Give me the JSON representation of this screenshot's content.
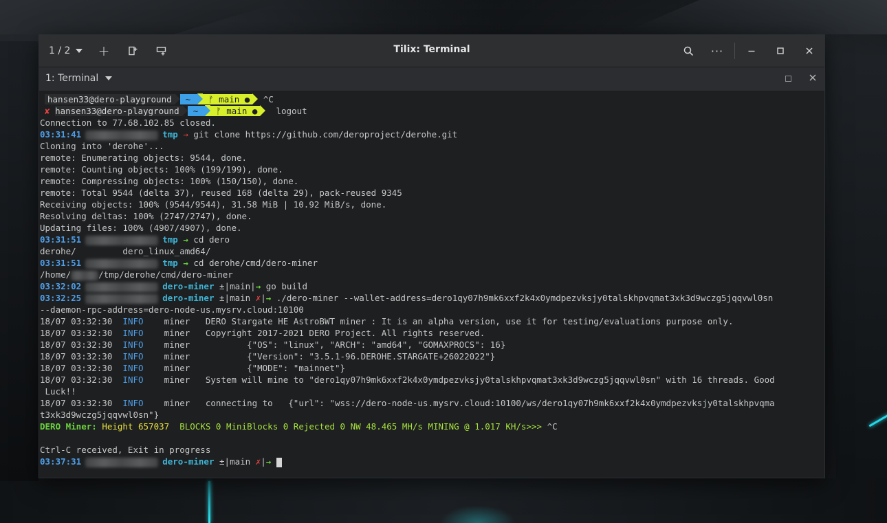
{
  "window": {
    "title": "Tilix: Terminal",
    "session_switcher": "1 / 2",
    "terminal_title": "1: Terminal"
  },
  "prompts": {
    "remote_user": "hansen33@dero-playground",
    "remote_dir": "~",
    "remote_branch": "ᚠ main ●",
    "x_mark": "✘",
    "ctrl_c": "^C",
    "logout": "logout"
  },
  "lines": {
    "l3": "Connection to 77.68.102.85 closed.",
    "p1_time": "03:31:41",
    "p1_dir": "tmp",
    "p1_cmd": "git clone https://github.com/deroproject/derohe.git",
    "l5": "Cloning into 'derohe'...",
    "l6": "remote: Enumerating objects: 9544, done.",
    "l7": "remote: Counting objects: 100% (199/199), done.",
    "l8": "remote: Compressing objects: 100% (150/150), done.",
    "l9": "remote: Total 9544 (delta 37), reused 168 (delta 29), pack-reused 9345",
    "l10": "Receiving objects: 100% (9544/9544), 31.58 MiB | 10.92 MiB/s, done.",
    "l11": "Resolving deltas: 100% (2747/2747), done.",
    "l12": "Updating files: 100% (4907/4907), done.",
    "p2_time": "03:31:51",
    "p2_dir": "tmp",
    "p2_cmd": "cd dero",
    "l14a": "derohe/",
    "l14b": "dero_linux_amd64/",
    "p3_time": "03:31:51",
    "p3_dir": "tmp",
    "p3_cmd": "cd derohe/cmd/dero-miner",
    "l16a": "/home/",
    "l16b": "/tmp/derohe/cmd/dero-miner",
    "p4_time": "03:32:02",
    "p4_dir": "dero-miner",
    "p4_git": "±|main|",
    "p4_cmd": "go build",
    "p5_time": "03:32:25",
    "p5_dir": "dero-miner",
    "p5_git": "±|main ",
    "p5_x": "✗",
    "p5_git2": "|",
    "p5_cmd": "./dero-miner --wallet-address=dero1qy07h9mk6xxf2k4x0ymdpezvksjy0talskhpvqmat3xk3d9wczg5jqqvwl0sn",
    "l19": "--daemon-rpc-address=dero-node-us.mysrv.cloud:10100",
    "log_ts": "18/07 03:32:30",
    "log_level": "INFO",
    "log_src": "miner",
    "log1": "DERO Stargate HE AstroBWT miner : It is an alpha version, use it for testing/evaluations purpose only.",
    "log2": "Copyright 2017-2021 DERO Project. All rights reserved.",
    "log3": "        {\"OS\": \"linux\", \"ARCH\": \"amd64\", \"GOMAXPROCS\": 16}",
    "log4": "        {\"Version\": \"3.5.1-96.DEROHE.STARGATE+26022022\"}",
    "log5": "        {\"MODE\": \"mainnet\"}",
    "log6": "System will mine to \"dero1qy07h9mk6xxf2k4x0ymdpezvksjy0talskhpvqmat3xk3d9wczg5jqqvwl0sn\" with 16 threads. Good",
    "log6b": "Luck!!",
    "log7": "connecting to   {\"url\": \"wss://dero-node-us.mysrv.cloud:10100/ws/dero1qy07h9mk6xxf2k4x0ymdpezvksjy0talskhpvqma",
    "log7b": "t3xk3d9wczg5jqqvwl0sn\"}",
    "miner_label": "DERO Miner:",
    "miner_height": "Height 657037",
    "miner_stats": "BLOCKS 0 MiniBlocks 0 Rejected 0 NW 48.465 MH/s MINING @ 1.017 KH/s>>>",
    "miner_ctrl": "^C",
    "exit_msg": "Ctrl-C received, Exit in progress",
    "p6_time": "03:37:31",
    "p6_dir": "dero-miner",
    "p6_git": "±|main ",
    "p6_x": "✗",
    "p6_git2": "|"
  },
  "arrow": "→",
  "colors": {
    "accent_blue": "#4f9fe8",
    "accent_cyan": "#3fb5d6",
    "powerline_blue": "#3ea0e6",
    "powerline_yellow": "#d8f02b",
    "miner_green": "#6bd33c"
  }
}
